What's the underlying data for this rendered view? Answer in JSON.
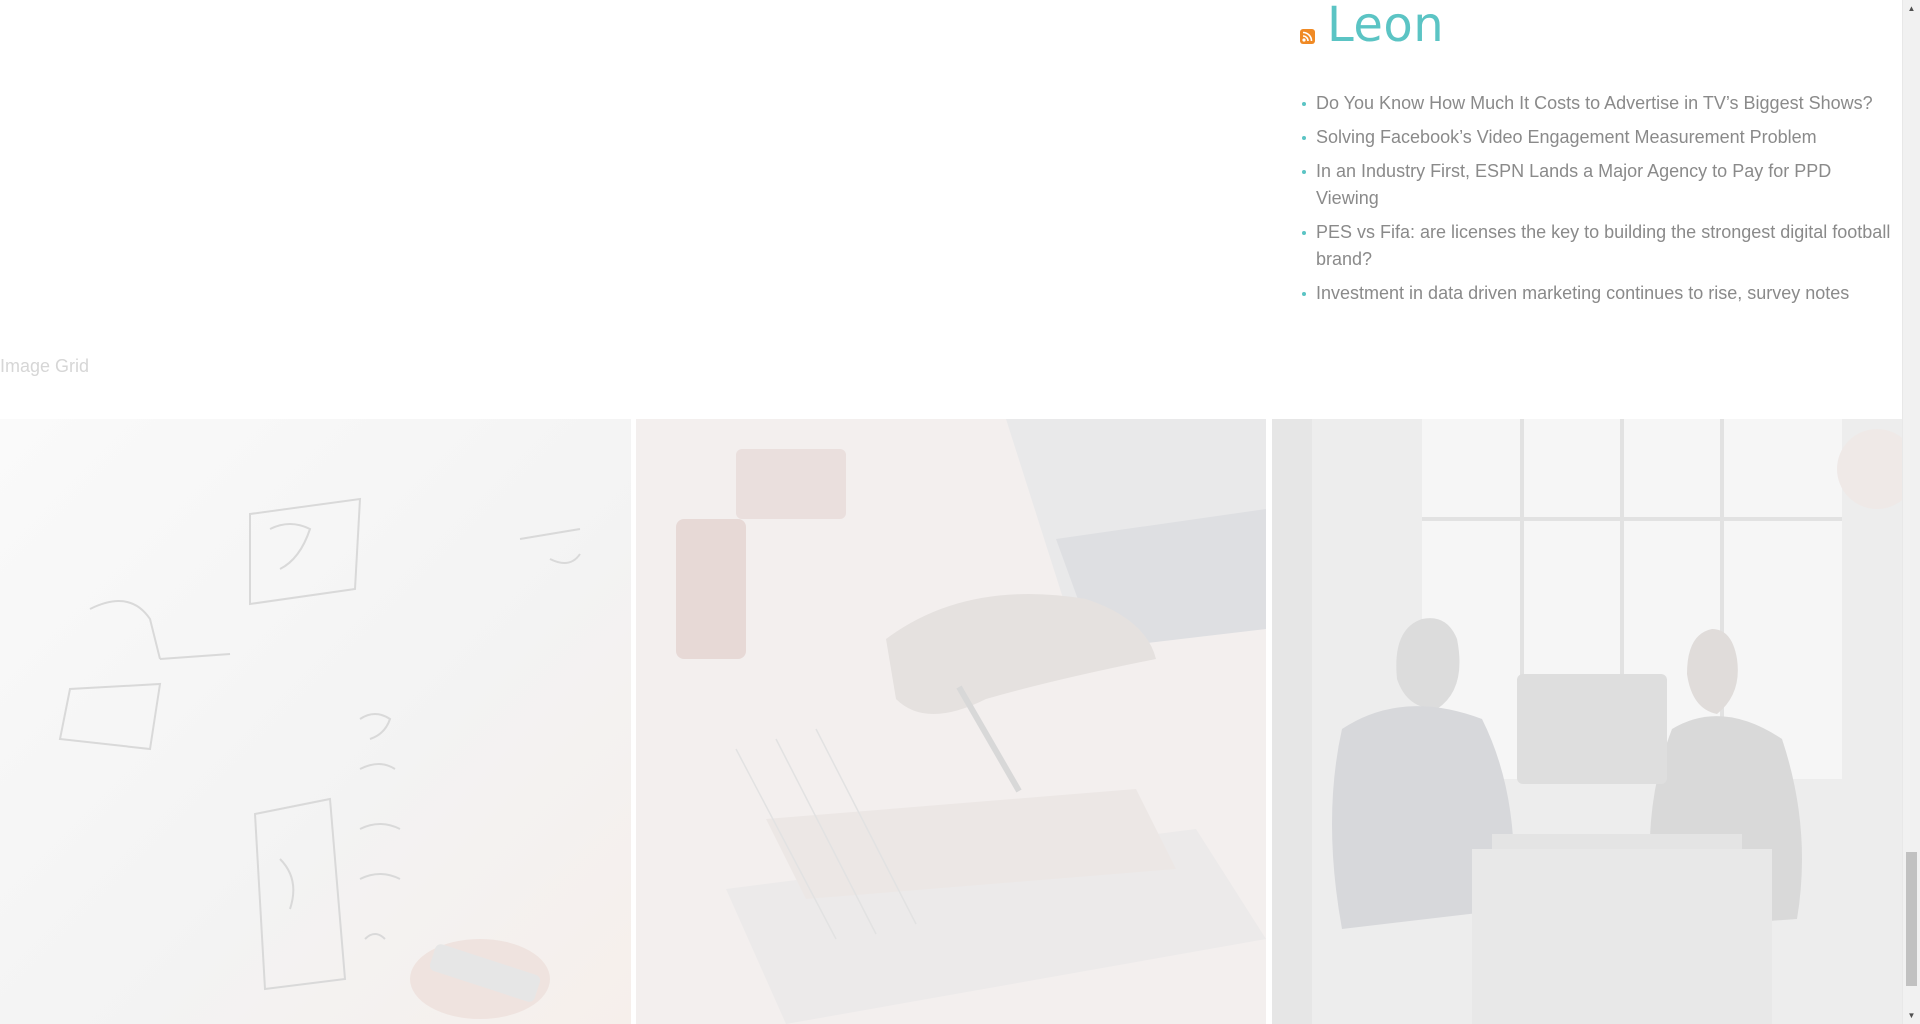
{
  "rss": {
    "title": "Leon",
    "icon": "rss-feed-icon",
    "accent_color": "#5bc4c4",
    "icon_color": "#f08a24",
    "items": [
      {
        "label": "Do You Know How Much It Costs to Advertise in TV’s Biggest Shows?"
      },
      {
        "label": "Solving Facebook’s Video Engagement Measurement Problem"
      },
      {
        "label": "In an Industry First, ESPN Lands a Major Agency to Pay for PPD Viewing"
      },
      {
        "label": "PES vs Fifa: are licenses the key to building the strongest digital football brand?"
      },
      {
        "label": "Investment in data driven marketing continues to rise, survey notes"
      }
    ]
  },
  "image_grid": {
    "heading": "Image Grid",
    "images": [
      {
        "name": "whiteboard-sketch-image"
      },
      {
        "name": "desk-writing-image"
      },
      {
        "name": "meeting-laptop-image"
      }
    ]
  },
  "scrollbar": {
    "up_icon": "scroll-up-arrow-icon",
    "down_icon": "scroll-down-arrow-icon"
  }
}
